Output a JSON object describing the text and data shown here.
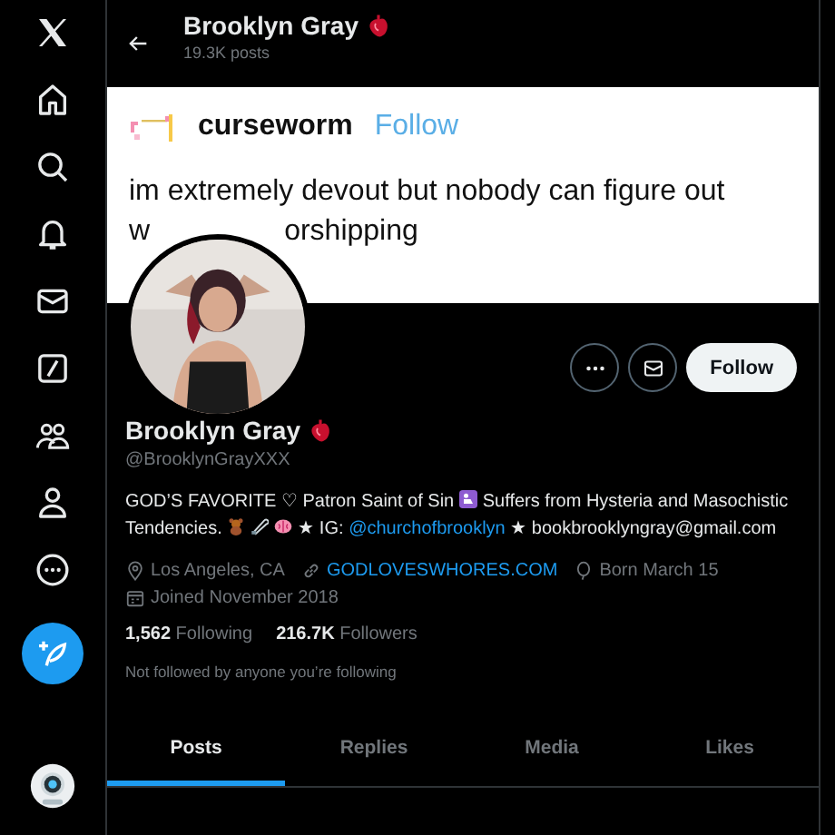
{
  "header": {
    "title": "Brooklyn Gray",
    "subtitle": "19.3K posts"
  },
  "banner": {
    "author": "curseworm",
    "follow": "Follow",
    "line": "im extremely devout but nobody can figure out",
    "partial_start": "w",
    "partial_end": "orshipping"
  },
  "actions": {
    "follow": "Follow"
  },
  "profile": {
    "name": "Brooklyn Gray",
    "handle": "@BrooklynGrayXXX",
    "bio": [
      {
        "kind": "text",
        "text": "GOD’S FAVORITE ♡ Patron Saint of Sin"
      },
      {
        "kind": "emoji"
      },
      {
        "kind": "text",
        "text": "Suffers from Hysteria and Masochistic Tendencies."
      },
      {
        "kind": "emoji"
      },
      {
        "kind": "emoji"
      },
      {
        "kind": "emoji"
      },
      {
        "kind": "text",
        "text": "★ IG:"
      },
      {
        "kind": "link",
        "text": "@churchofbrooklyn"
      },
      {
        "kind": "text",
        "text": "★ bookbrooklyngray@gmail.com"
      }
    ],
    "location": "Los Angeles, CA",
    "website": "GODLOVESWHORES.COM",
    "birthday": "Born March 15",
    "joined": "Joined November 2018",
    "following_count": "1,562",
    "following_label": "Following",
    "followers_count": "216.7K",
    "followers_label": "Followers",
    "note": "Not followed by anyone you’re following"
  },
  "tabs": [
    {
      "label": "Posts",
      "selected": true
    },
    {
      "label": "Replies",
      "selected": false
    },
    {
      "label": "Media",
      "selected": false
    },
    {
      "label": "Likes",
      "selected": false
    }
  ]
}
